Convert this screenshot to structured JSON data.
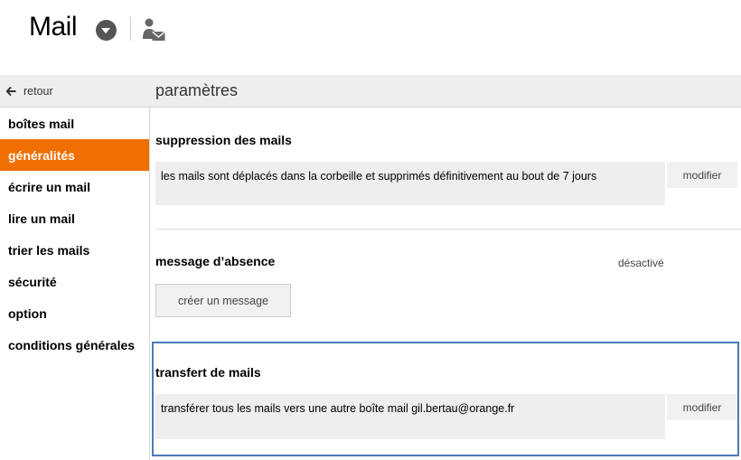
{
  "header": {
    "app_title": "Mail"
  },
  "topbar": {
    "back_label": "retour",
    "settings_title": "paramètres"
  },
  "sidebar": {
    "items": [
      {
        "label": "boîtes mail"
      },
      {
        "label": "généralités",
        "active": true
      },
      {
        "label": "écrire un mail"
      },
      {
        "label": "lire un mail"
      },
      {
        "label": "trier les mails"
      },
      {
        "label": "sécurité"
      },
      {
        "label": "option"
      },
      {
        "label": "conditions générales"
      }
    ]
  },
  "sections": {
    "deletion": {
      "title": "suppression des mails",
      "description": "les mails sont déplacés dans la corbeille et supprimés définitivement au bout de 7 jours",
      "modify_label": "modifier"
    },
    "absence": {
      "title": "message d’absence",
      "status": "désactivé",
      "create_label": "créer un message"
    },
    "transfer": {
      "title": "transfert de mails",
      "description": "transférer tous les mails vers une autre boîte mail gil.bertau@orange.fr",
      "modify_label": "modifier"
    }
  },
  "colors": {
    "accent": "#f16e00",
    "highlight_border": "#4a7ab8"
  }
}
